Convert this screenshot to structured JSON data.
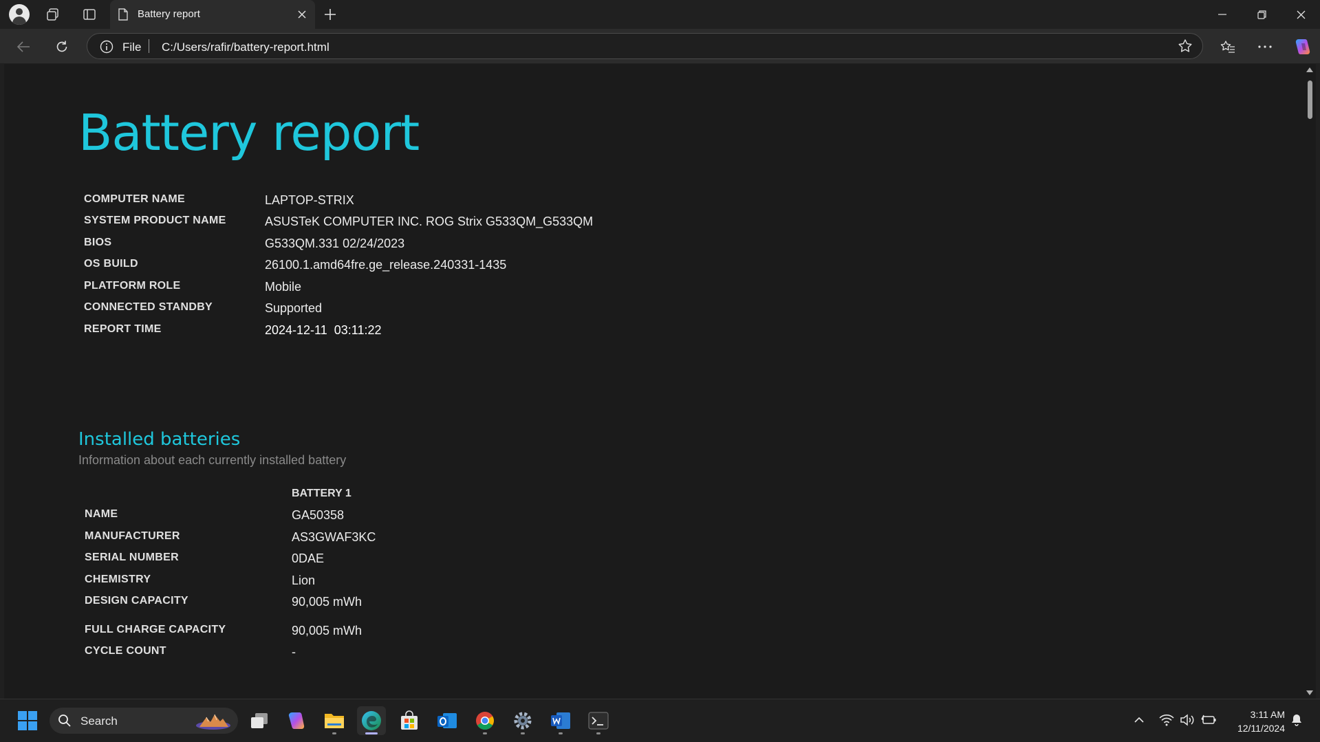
{
  "browser": {
    "tab_title": "Battery report",
    "address_scheme": "File",
    "address_url": "C:/Users/rafir/battery-report.html"
  },
  "report": {
    "title": "Battery report",
    "system_info": [
      {
        "label": "COMPUTER NAME",
        "value": "LAPTOP-STRIX"
      },
      {
        "label": "SYSTEM PRODUCT NAME",
        "value": "ASUSTeK COMPUTER INC. ROG Strix G533QM_G533QM"
      },
      {
        "label": "BIOS",
        "value": "G533QM.331 02/24/2023"
      },
      {
        "label": "OS BUILD",
        "value": "26100.1.amd64fre.ge_release.240331-1435"
      },
      {
        "label": "PLATFORM ROLE",
        "value": "Mobile"
      },
      {
        "label": "CONNECTED STANDBY",
        "value": "Supported"
      },
      {
        "label": "REPORT TIME",
        "value": "2024-12-11  03:11:22"
      }
    ],
    "installed_batteries": {
      "title": "Installed batteries",
      "subtitle": "Information about each currently installed battery",
      "column_header": "BATTERY 1",
      "rows": [
        {
          "label": "NAME",
          "value": "GA50358"
        },
        {
          "label": "MANUFACTURER",
          "value": "AS3GWAF3KC"
        },
        {
          "label": "SERIAL NUMBER",
          "value": "0DAE"
        },
        {
          "label": "CHEMISTRY",
          "value": "Lion"
        },
        {
          "label": "DESIGN CAPACITY",
          "value": "90,005 mWh"
        },
        {
          "label": "FULL CHARGE CAPACITY",
          "value": "90,005 mWh"
        },
        {
          "label": "CYCLE COUNT",
          "value": "-"
        }
      ]
    }
  },
  "taskbar": {
    "search_label": "Search",
    "apps": [
      "task-view",
      "copilot",
      "file-explorer",
      "edge",
      "microsoft-store",
      "outlook",
      "chrome",
      "settings",
      "word",
      "terminal"
    ],
    "clock_time": "3:11 AM",
    "clock_date": "12/11/2024"
  },
  "colors": {
    "accent": "#1fc7dc",
    "content_bg": "#1b1b1b",
    "chrome_bg": "#202020"
  }
}
